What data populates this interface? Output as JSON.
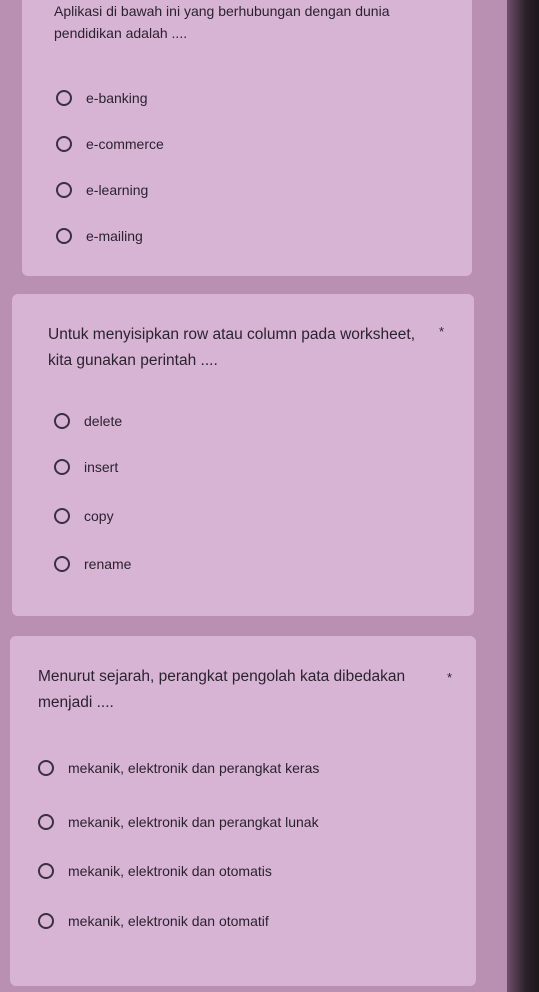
{
  "questions": [
    {
      "text": "Aplikasi di bawah ini yang berhubungan dengan dunia pendidikan adalah ....",
      "required_marker": "",
      "options": [
        "e-banking",
        "e-commerce",
        "e-learning",
        "e-mailing"
      ]
    },
    {
      "text": "Untuk menyisipkan row atau column pada worksheet, kita gunakan perintah ....",
      "required_marker": "*",
      "options": [
        "delete",
        "insert",
        "copy",
        "rename"
      ]
    },
    {
      "text": "Menurut sejarah, perangkat pengolah kata dibedakan menjadi ....",
      "required_marker": "*",
      "options": [
        "mekanik, elektronik dan perangkat keras",
        "mekanik, elektronik dan perangkat lunak",
        "mekanik, elektronik dan otomatis",
        "mekanik, elektronik dan otomatif"
      ]
    }
  ],
  "colors": {
    "background": "#b98fb2",
    "card": "#d7b4d3",
    "text": "#2b2230"
  }
}
